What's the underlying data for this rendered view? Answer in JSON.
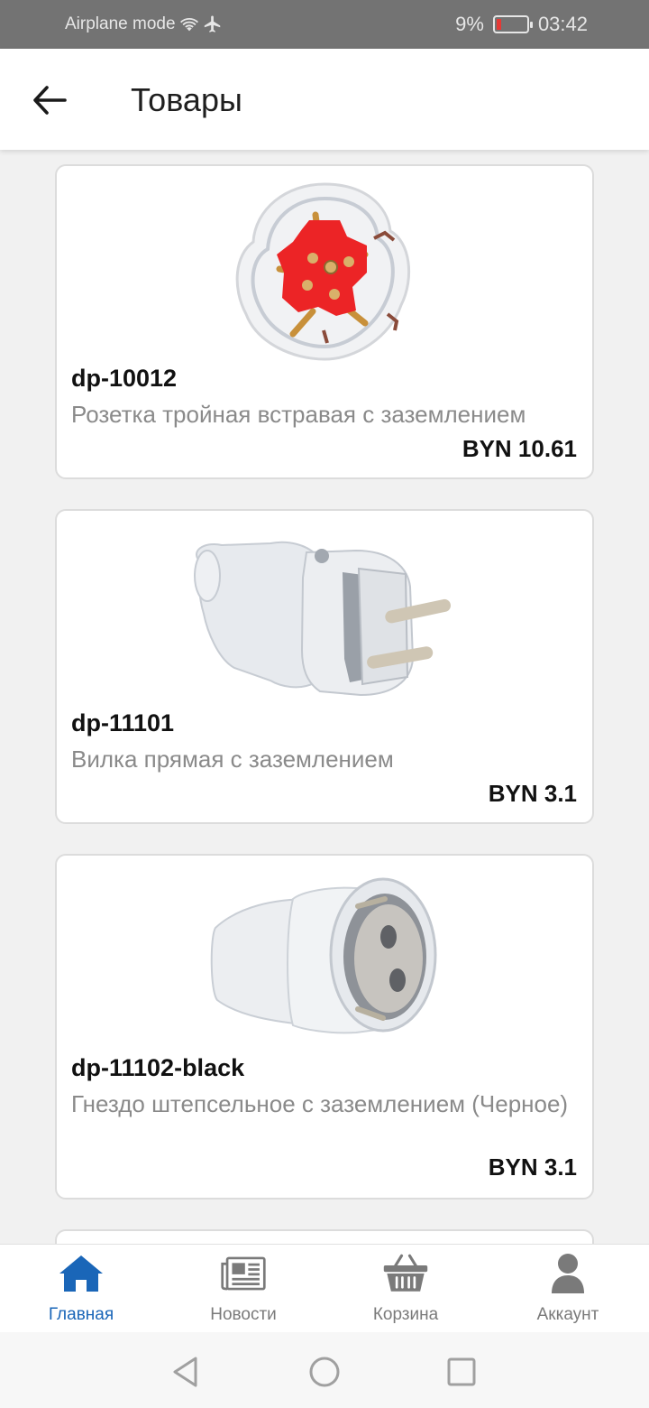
{
  "status_bar": {
    "left_text": "Airplane mode",
    "battery_percent": "9%",
    "time": "03:42",
    "icons": [
      "wifi-icon",
      "airplane-icon",
      "battery-icon"
    ]
  },
  "header": {
    "title": "Товары",
    "back_icon": "arrow-left-icon"
  },
  "products": [
    {
      "sku": "dp-10012",
      "name": "Розетка тройная встравая с заземлением",
      "price": "BYN 10.61",
      "image": "triple-socket-image"
    },
    {
      "sku": "dp-11101",
      "name": "Вилка прямая с заземлением",
      "price": "BYN 3.1",
      "image": "plug-image"
    },
    {
      "sku": "dp-11102-black",
      "name": "Гнездо штепсельное с заземлением (Черное)",
      "price": "BYN 3.1",
      "image": "socket-connector-image"
    }
  ],
  "bottom_nav": [
    {
      "label": "Главная",
      "icon": "home-icon",
      "active": true
    },
    {
      "label": "Новости",
      "icon": "newspaper-icon",
      "active": false
    },
    {
      "label": "Корзина",
      "icon": "basket-icon",
      "active": false
    },
    {
      "label": "Аккаунт",
      "icon": "user-icon",
      "active": false
    }
  ],
  "colors": {
    "accent": "#1a66b8",
    "inactive": "#7a7a7a",
    "status_bar": "#737373",
    "background": "#f1f1f1"
  },
  "system_nav": [
    "back-triangle-icon",
    "home-circle-icon",
    "recents-square-icon"
  ]
}
